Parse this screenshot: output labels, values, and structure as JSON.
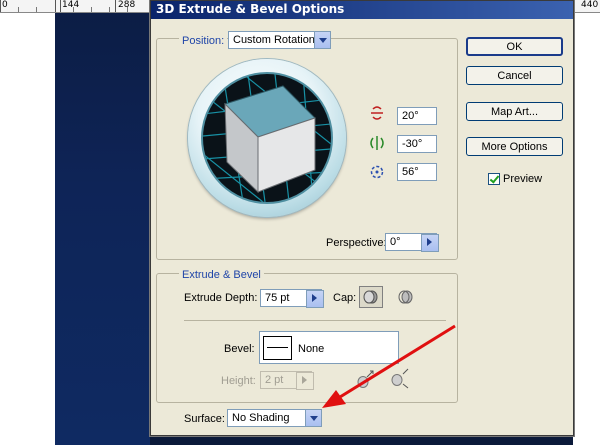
{
  "ruler": {
    "labels": [
      "0",
      "144",
      "288",
      "440"
    ]
  },
  "dialog": {
    "title": "3D Extrude & Bevel Options",
    "position": {
      "legend": "Position:",
      "preset": "Custom Rotation",
      "rotate_x": "20°",
      "rotate_y": "-30°",
      "rotate_z": "56°",
      "perspective_label": "Perspective:",
      "perspective_value": "0°"
    },
    "buttons": {
      "ok": "OK",
      "cancel": "Cancel",
      "map_art": "Map Art...",
      "more_options": "More Options"
    },
    "preview": {
      "label": "Preview",
      "checked": true
    },
    "extrude_bevel": {
      "legend": "Extrude & Bevel",
      "depth_label": "Extrude Depth:",
      "depth_value": "75 pt",
      "cap_label": "Cap:",
      "bevel_label": "Bevel:",
      "bevel_value": "None",
      "height_label": "Height:",
      "height_value": "2 pt"
    },
    "surface": {
      "label": "Surface:",
      "value": "No Shading"
    }
  },
  "colors": {
    "titlebar": "#0a246a",
    "cube_face": "#6aa7b9",
    "annotation_arrow": "#e01010",
    "legend_text": "#1f45a8"
  },
  "icons": [
    "rotate-x-icon",
    "rotate-y-icon",
    "rotate-z-icon",
    "cap-on-icon",
    "cap-off-icon",
    "bevel-in-icon",
    "bevel-out-icon",
    "checkmark-icon"
  ]
}
